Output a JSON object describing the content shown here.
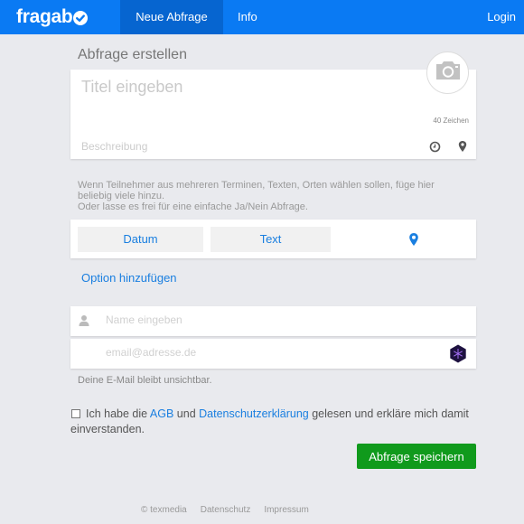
{
  "navbar": {
    "brand": "fragab",
    "items": [
      {
        "label": "Neue Abfrage",
        "active": true
      },
      {
        "label": "Info",
        "active": false
      }
    ],
    "login_label": "Login"
  },
  "form": {
    "section_title": "Abfrage erstellen",
    "title_placeholder": "Titel eingeben",
    "title_value": "",
    "char_count": "40 Zeichen",
    "description_placeholder": "Beschreibung",
    "description_value": "",
    "hint_line1": "Wenn Teilnehmer aus mehreren Terminen, Texten, Orten wählen sollen, füge hier beliebig viele hinzu.",
    "hint_line2": "Oder lasse es frei für eine einfache Ja/Nein Abfrage.",
    "option_types": [
      {
        "label": "Datum"
      },
      {
        "label": "Text"
      },
      {
        "icon": "map-pin-icon"
      }
    ],
    "add_option_label": "Option hinzufügen",
    "name_placeholder": "Name eingeben",
    "email_placeholder": "email@adresse.de",
    "email_note": "Deine E-Mail bleibt unsichtbar.",
    "terms": {
      "checked": false,
      "text_before": "Ich habe die ",
      "agb_link": "AGB",
      "text_middle": " und ",
      "privacy_link": "Datenschutzerklärung",
      "text_after": " gelesen und erkläre mich damit einverstanden."
    },
    "save_label": "Abfrage speichern"
  },
  "footer": {
    "copyright": "© texmedia",
    "links": [
      "Datenschutz",
      "Impressum"
    ]
  },
  "colors": {
    "navbar": "#0a7af3",
    "navbar_active": "#0665d0",
    "link": "#1a7fe0",
    "save_button": "#109a1c",
    "background": "#e9eaee"
  }
}
